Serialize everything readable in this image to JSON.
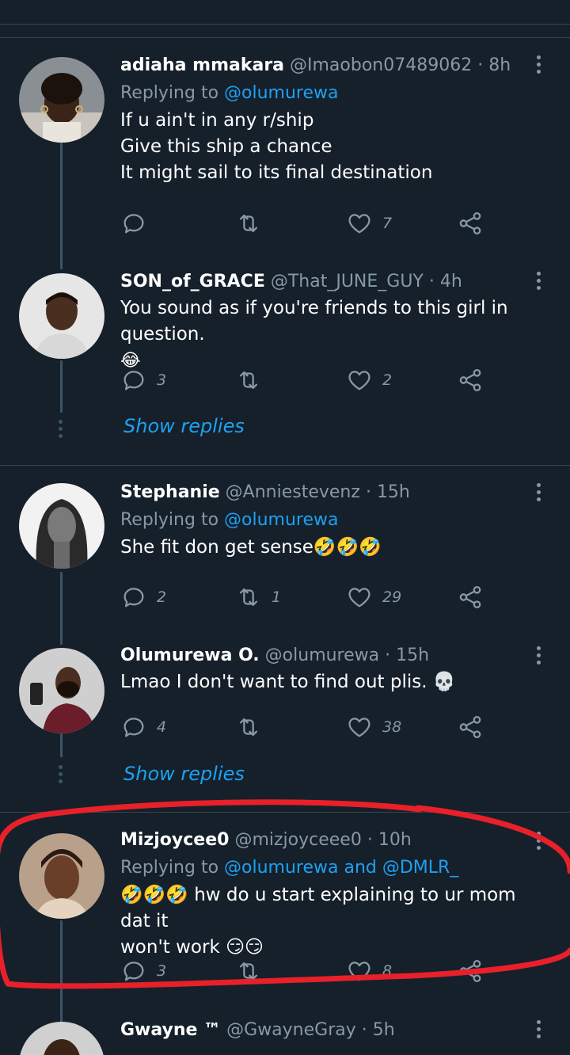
{
  "tweets": [
    {
      "name": "adiaha mmakara",
      "handle": "@Imaobon07489062",
      "time": "8h",
      "replying_prefix": "Replying to",
      "replying_to": "@olumurewa",
      "lines": [
        "If u ain't in any r/ship",
        "Give this ship a chance",
        "It might sail to its final destination"
      ],
      "reply_count": "",
      "retweet_count": "",
      "like_count": "7"
    },
    {
      "name": "SON_of_GRACE",
      "handle": "@That_JUNE_GUY",
      "time": "4h",
      "lines": [
        "You sound as if you're friends to this girl in question.",
        "😂"
      ],
      "reply_count": "3",
      "retweet_count": "",
      "like_count": "2"
    },
    {
      "name": "Stephanie",
      "handle": "@Anniestevenz",
      "time": "15h",
      "replying_prefix": "Replying to",
      "replying_to": "@olumurewa",
      "lines": [
        "She fit don get sense🤣🤣🤣"
      ],
      "reply_count": "2",
      "retweet_count": "1",
      "like_count": "29"
    },
    {
      "name": "Olumurewa O.",
      "handle": "@olumurewa",
      "time": "15h",
      "lines": [
        "Lmao I don't want to find out plis. 💀"
      ],
      "reply_count": "4",
      "retweet_count": "",
      "like_count": "38"
    },
    {
      "name": "Mizjoycee0",
      "handle": "@mizjoyceee0",
      "time": "10h",
      "replying_prefix": "Replying to",
      "replying_to": "@olumurewa and @DMLR_",
      "lines": [
        "🤣🤣🤣 hw do u start explaining to ur mom dat it",
        "won't work 😏😏"
      ],
      "reply_count": "3",
      "retweet_count": "",
      "like_count": "8"
    },
    {
      "name": "Gwayne ™",
      "handle": "@GwayneGray",
      "time": "5h"
    }
  ],
  "show_replies_label": "Show replies",
  "separator": "·",
  "colors": {
    "background": "#15202b",
    "link": "#1da1f2",
    "muted": "#8899a6",
    "annotation": "#e8202a"
  },
  "icons": [
    "reply-icon",
    "retweet-icon",
    "like-icon",
    "share-icon",
    "more-icon"
  ]
}
